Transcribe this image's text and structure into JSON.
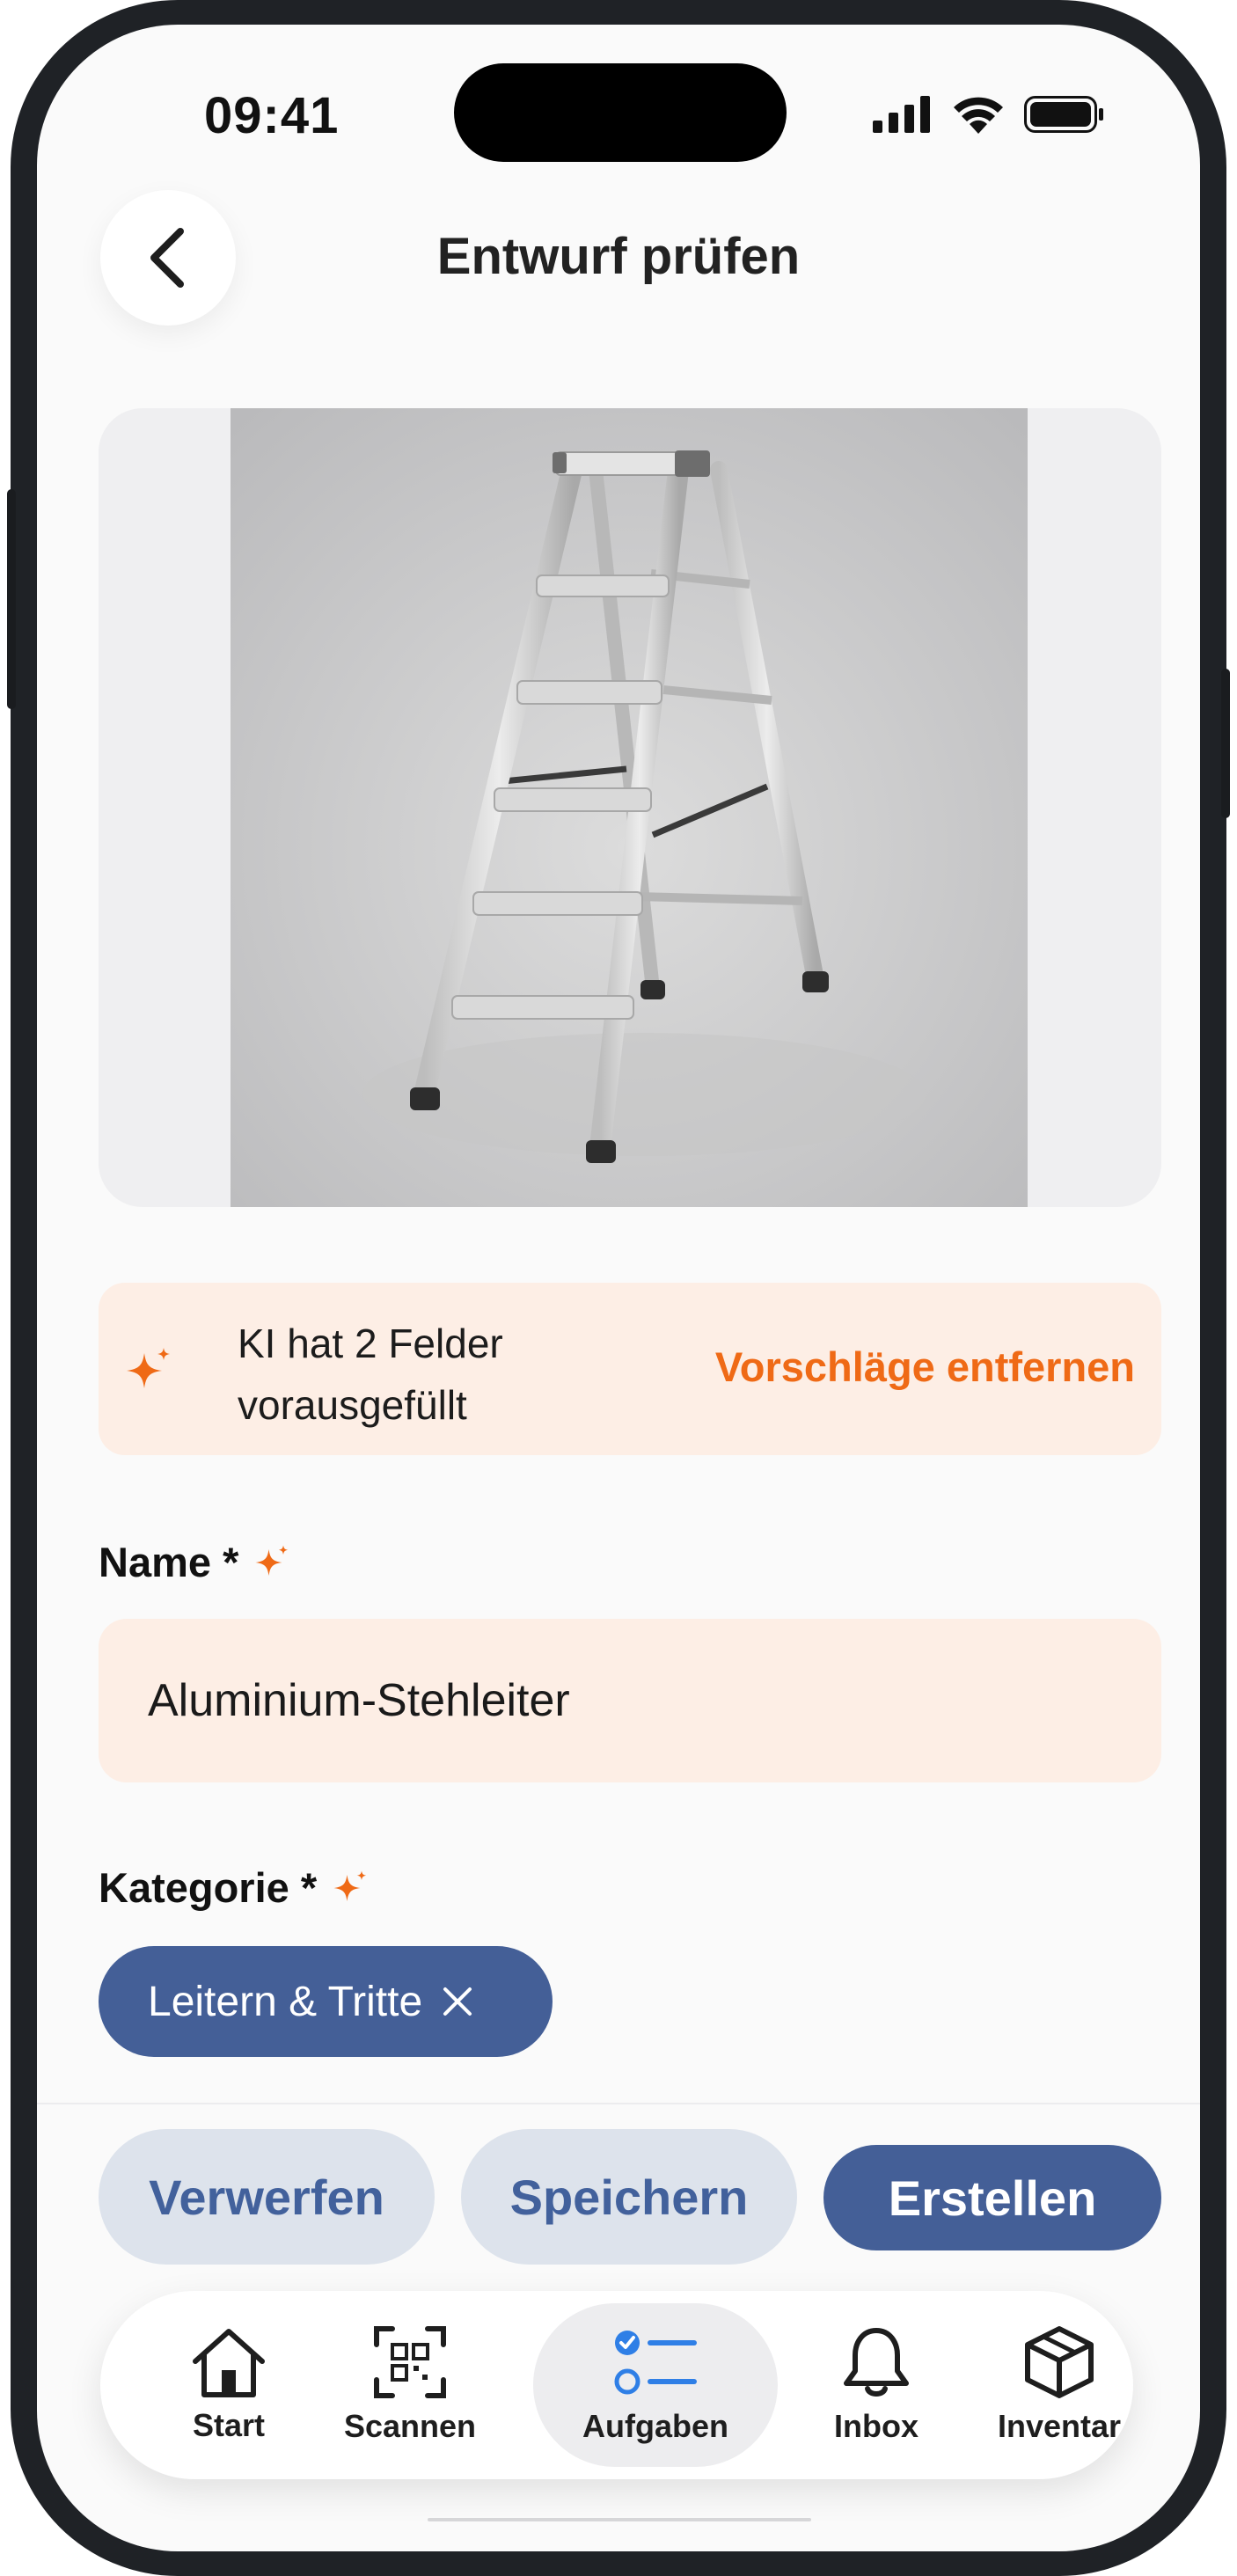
{
  "status_bar": {
    "time": "09:41"
  },
  "header": {
    "title": "Entwurf prüfen",
    "back_icon": "chevron-left-icon"
  },
  "ai_banner": {
    "text_line1": "KI hat 2 Felder",
    "text_line2": "vorausgefüllt",
    "action": "Vorschläge entfernen",
    "icon": "sparkle-icon",
    "accent": "#ef6a16",
    "background": "#fdeee5"
  },
  "fields": {
    "name": {
      "label": "Name *",
      "value": "Aluminium-Stehleiter",
      "ai_filled": true
    },
    "category": {
      "label": "Kategorie *",
      "chip": "Leitern & Tritte",
      "ai_filled": true
    }
  },
  "actions": {
    "discard": "Verwerfen",
    "save": "Speichern",
    "create": "Erstellen",
    "primary_color": "#445f97"
  },
  "tabbar": {
    "tabs": [
      {
        "label": "Start",
        "icon": "home-icon",
        "active": false
      },
      {
        "label": "Scannen",
        "icon": "qr-scan-icon",
        "active": false
      },
      {
        "label": "Aufgaben",
        "icon": "checklist-icon",
        "active": true
      },
      {
        "label": "Inbox",
        "icon": "bell-icon",
        "active": false
      },
      {
        "label": "Inventar",
        "icon": "box-icon",
        "active": false
      }
    ]
  }
}
